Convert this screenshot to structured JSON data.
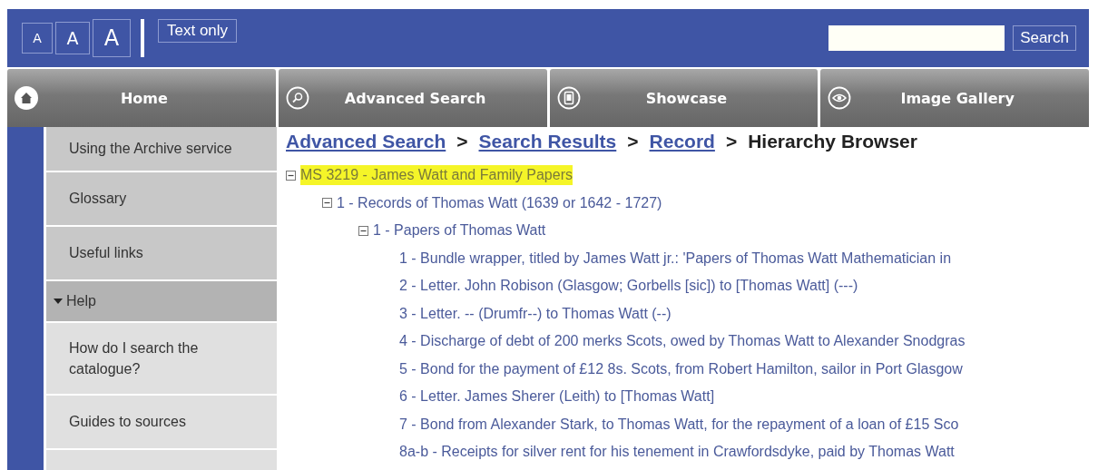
{
  "header": {
    "font_size_buttons": [
      {
        "label": "A"
      },
      {
        "label": "A"
      },
      {
        "label": "A"
      }
    ],
    "text_only": "Text only",
    "search": {
      "button": "Search"
    }
  },
  "nav_tabs": [
    {
      "label": "Home"
    },
    {
      "label": "Advanced Search"
    },
    {
      "label": "Showcase"
    },
    {
      "label": "Image Gallery"
    }
  ],
  "sidebar": {
    "items": [
      {
        "label": "Using the Archive service",
        "kind": "link"
      },
      {
        "label": "Glossary",
        "kind": "link"
      },
      {
        "label": "Useful links",
        "kind": "link"
      },
      {
        "label": "Help",
        "kind": "section",
        "expanded": true,
        "children": [
          {
            "label": "How do I search the catalogue?",
            "kind": "sublink"
          },
          {
            "label": "Guides to sources",
            "kind": "sublink"
          },
          {
            "kind": "sublink"
          }
        ]
      }
    ]
  },
  "breadcrumb": [
    {
      "label": "Advanced Search",
      "kind": "link",
      "separator": ">"
    },
    {
      "label": "Search Results",
      "kind": "link",
      "separator": ">"
    },
    {
      "label": "Record",
      "kind": "link",
      "separator": ">"
    },
    {
      "label": "Hierarchy Browser",
      "kind": "current"
    }
  ],
  "tree": [
    {
      "label": "MS 3219 - James Watt and Family Papers",
      "selected": true,
      "expanded": true,
      "children": [
        {
          "label": "1 - Records of Thomas Watt (1639 or 1642 - 1727)",
          "selected": false,
          "expanded": true,
          "children": [
            {
              "label": "1 - Papers of Thomas Watt",
              "selected": false,
              "expanded": true,
              "children": [
                {
                  "label": "1 - Bundle wrapper, titled by James Watt jr.: 'Papers of Thomas Watt Mathematician in",
                  "selected": false
                },
                {
                  "label": "2 - Letter. John Robison (Glasgow; Gorbells [sic]) to [Thomas Watt] (---)",
                  "selected": false
                },
                {
                  "label": "3 - Letter. -- (Drumfr--) to Thomas Watt (--)",
                  "selected": false
                },
                {
                  "label": "4 - Discharge of debt of 200 merks Scots, owed by Thomas Watt to Alexander Snodgras",
                  "selected": false
                },
                {
                  "label": "5 - Bond for the payment of £12 8s. Scots, from Robert Hamilton, sailor in Port Glasgow",
                  "selected": false
                },
                {
                  "label": "6 - Letter. James Sherer (Leith) to [Thomas Watt]",
                  "selected": false
                },
                {
                  "label": "7 - Bond from Alexander Stark, to Thomas Watt, for the repayment of a loan of £15 Sco",
                  "selected": false
                },
                {
                  "label": "8a-b - Receipts for silver rent for his tenement in Crawfordsdyke, paid by Thomas Watt",
                  "selected": false
                }
              ]
            }
          ]
        }
      ]
    }
  ]
}
